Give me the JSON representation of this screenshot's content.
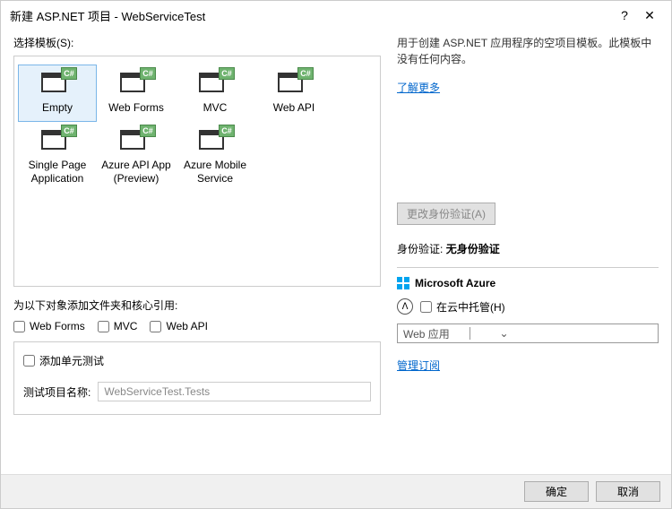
{
  "title": "新建 ASP.NET 项目 - WebServiceTest",
  "sectionTemplates": "选择模板(S):",
  "templates": [
    {
      "label": "Empty",
      "selected": true
    },
    {
      "label": "Web Forms"
    },
    {
      "label": "MVC"
    },
    {
      "label": "Web API"
    },
    {
      "label": "Single Page Application"
    },
    {
      "label": "Azure API App (Preview)"
    },
    {
      "label": "Azure Mobile Service"
    }
  ],
  "referencesLabel": "为以下对象添加文件夹和核心引用:",
  "refOptions": {
    "webforms": "Web Forms",
    "mvc": "MVC",
    "webapi": "Web API"
  },
  "unitTest": {
    "add": "添加单元测试",
    "nameLabel": "测试项目名称:",
    "nameValue": "WebServiceTest.Tests"
  },
  "description": "用于创建 ASP.NET 应用程序的空项目模板。此模板中没有任何内容。",
  "learnMore": "了解更多",
  "auth": {
    "changeBtn": "更改身份验证(A)",
    "label": "身份验证:",
    "value": "无身份验证"
  },
  "azure": {
    "title": "Microsoft Azure",
    "host": "在云中托管(H)",
    "comboValue": "Web 应用",
    "manage": "管理订阅"
  },
  "buttons": {
    "ok": "确定",
    "cancel": "取消"
  }
}
